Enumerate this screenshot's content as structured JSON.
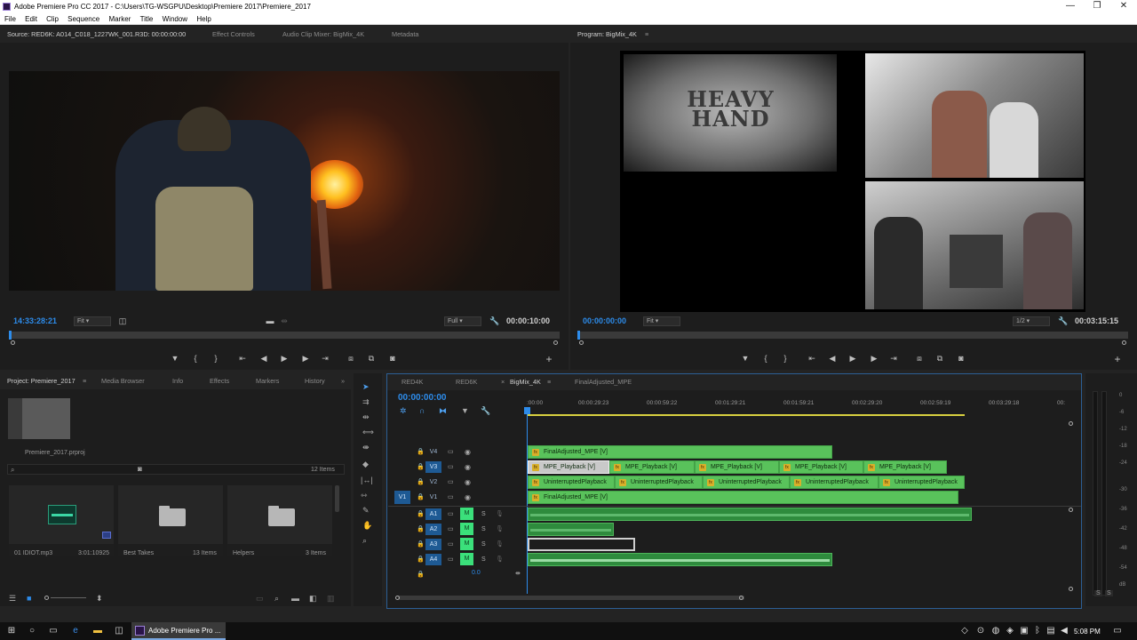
{
  "window": {
    "title": "Adobe Premiere Pro CC 2017 - C:\\Users\\TG-WSGPU\\Desktop\\Premiere 2017\\Premiere_2017",
    "minimize": "—",
    "maximize": "❐",
    "close": "✕"
  },
  "menu": [
    "File",
    "Edit",
    "Clip",
    "Sequence",
    "Marker",
    "Title",
    "Window",
    "Help"
  ],
  "source_panel": {
    "tabs": [
      "Source: RED6K: A014_C018_1227WK_001.R3D: 00:00:00:00",
      "Effect Controls",
      "Audio Clip Mixer: BigMix_4K",
      "Metadata"
    ],
    "timecode": "14:33:28:21",
    "fit": "Fit",
    "resolution": "Full",
    "duration": "00:00:10:00"
  },
  "program_panel": {
    "tab": "Program: BigMix_4K",
    "timecode": "00:00:00:00",
    "fit": "Fit",
    "resolution": "1/2",
    "duration": "00:03:15:15",
    "title_card": "HEAVY HAND"
  },
  "project_panel": {
    "tabs": [
      "Project: Premiere_2017",
      "Media Browser",
      "Info",
      "Effects",
      "Markers",
      "History"
    ],
    "project_file": "Premiere_2017.prproj",
    "item_count": "12 Items",
    "items": [
      {
        "name": "01 IDIOT.mp3",
        "meta": "3:01:10925"
      },
      {
        "name": "Best Takes",
        "meta": "13 Items"
      },
      {
        "name": "Helpers",
        "meta": "3 Items"
      }
    ]
  },
  "timeline": {
    "tabs": [
      "RED4K",
      "RED6K",
      "BigMix_4K",
      "FinalAdjusted_MPE"
    ],
    "timecode": "00:00:00:00",
    "ruler": [
      ":00:00",
      "00:00:29:23",
      "00:00:59:22",
      "00:01:29:21",
      "00:01:59:21",
      "00:02:29:20",
      "00:02:59:19",
      "00:03:29:18",
      "00:"
    ],
    "video_tracks": [
      "V4",
      "V3",
      "V2",
      "V1"
    ],
    "audio_tracks": [
      "A1",
      "A2",
      "A3",
      "A4"
    ],
    "source_patch_v": "V1",
    "mute": "M",
    "solo": "S",
    "master_value": "0.0",
    "clips": {
      "v4": "FinalAdjusted_MPE [V]",
      "v3": [
        "MPE_Playback [V]",
        "MPE_Playback [V]",
        "MPE_Playback [V]",
        "MPE_Playback [V]",
        "MPE_Playback [V]"
      ],
      "v2": [
        "UninterruptedPlayback",
        "UninterruptedPlayback",
        "UninterruptedPlayback",
        "UninterruptedPlayback",
        "UninterruptedPlayback"
      ],
      "v1": "FinalAdjusted_MPE [V]"
    }
  },
  "meters": [
    "0",
    "-6",
    "-12",
    "-18",
    "-24",
    "-30",
    "-36",
    "-42",
    "-48",
    "-54",
    "dB"
  ],
  "meter_solo": [
    "S",
    "S"
  ],
  "taskbar": {
    "app": "Adobe Premiere Pro ...",
    "time": "5:08 PM"
  }
}
